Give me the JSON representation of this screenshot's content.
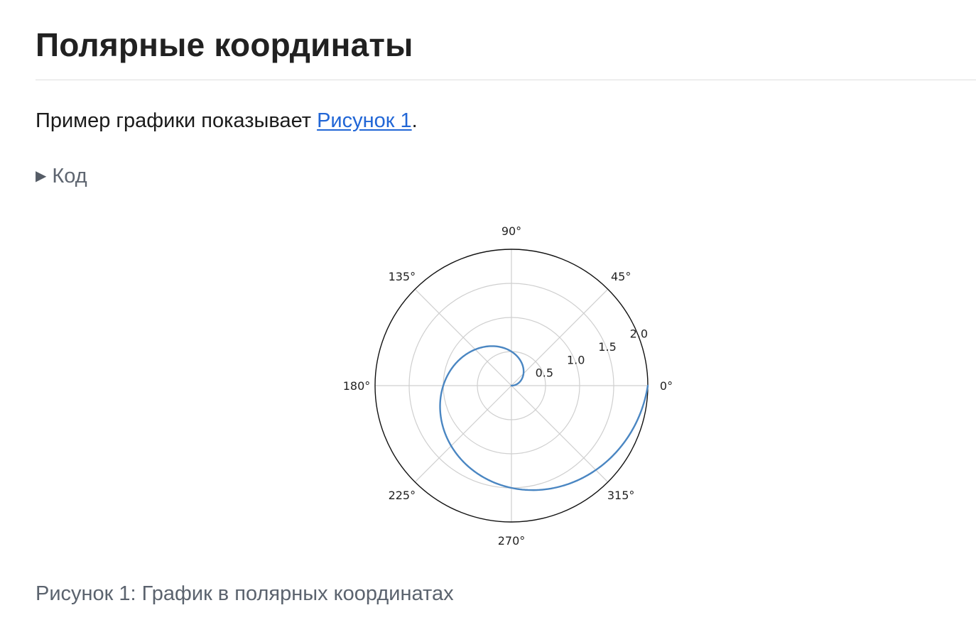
{
  "page": {
    "title": "Полярные координаты",
    "intro_text": "Пример графики показывает ",
    "intro_link": "Рисунок 1",
    "intro_suffix": ".",
    "details_label": "Код",
    "caption": "Рисунок 1: График в полярных координатах"
  },
  "colors": {
    "link": "#2166d6",
    "series": "#4a86c2",
    "grid": "#cfcfcf",
    "axis_outline": "#111111"
  },
  "icons": {
    "details_toggle": "triangle-right-icon"
  },
  "chart_data": {
    "type": "line",
    "projection": "polar",
    "title": "",
    "theta_tick_labels": [
      "0°",
      "45°",
      "90°",
      "135°",
      "180°",
      "225°",
      "270°",
      "315°"
    ],
    "theta_ticks_deg": [
      0,
      45,
      90,
      135,
      180,
      225,
      270,
      315
    ],
    "r_tick_labels": [
      "0.5",
      "1.0",
      "1.5",
      "2.0"
    ],
    "r_ticks": [
      0.5,
      1.0,
      1.5,
      2.0
    ],
    "rlim": [
      0,
      2.0
    ],
    "r_label_position_deg": 22.5,
    "grid": true,
    "series": [
      {
        "r": [
          0.0,
          0.2,
          0.4,
          0.6,
          0.8,
          1.0,
          1.2,
          1.4,
          1.6,
          1.8,
          2.0
        ],
        "theta_turns": [
          0.0,
          0.1,
          0.2,
          0.3,
          0.4,
          0.5,
          0.6,
          0.7,
          0.8,
          0.9,
          1.0
        ],
        "theta_rad": [
          0.0,
          0.628,
          1.257,
          1.885,
          2.513,
          3.142,
          3.77,
          4.398,
          5.027,
          5.655,
          6.283
        ]
      }
    ]
  }
}
